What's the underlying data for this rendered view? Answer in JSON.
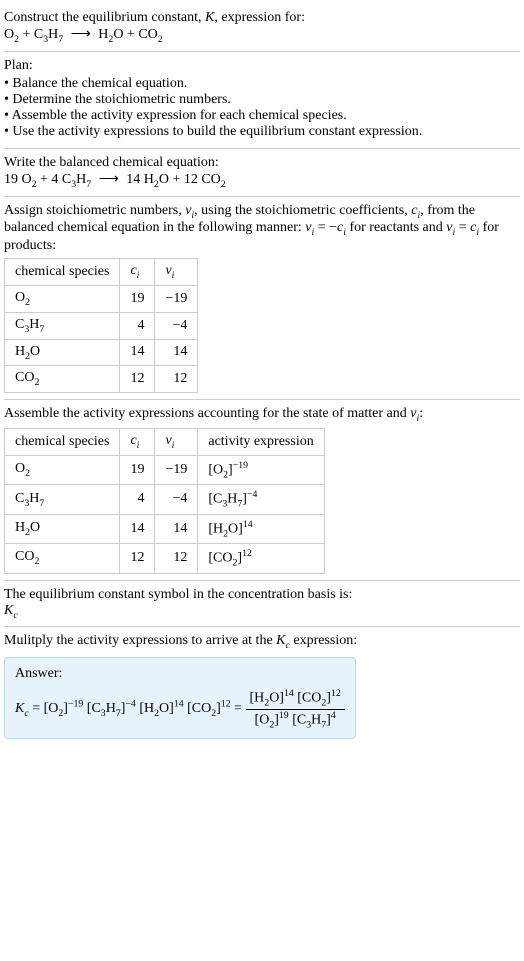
{
  "intro": {
    "line1": "Construct the equilibrium constant, ",
    "k": "K",
    "line1b": ", expression for:",
    "eq_lhs_o2": "O",
    "eq_lhs_o2_sub": "2",
    "eq_plus": " + C",
    "eq_lhs_c3": "3",
    "eq_lhs_h": "H",
    "eq_lhs_h7": "7",
    "arrow": "⟶",
    "eq_rhs_h2o_h": "H",
    "eq_rhs_h2o_2": "2",
    "eq_rhs_h2o_o": "O + CO",
    "eq_rhs_co2_2": "2"
  },
  "plan": {
    "title": "Plan:",
    "items": [
      "Balance the chemical equation.",
      "Determine the stoichiometric numbers.",
      "Assemble the activity expression for each chemical species.",
      "Use the activity expressions to build the equilibrium constant expression."
    ]
  },
  "balanced": {
    "title": "Write the balanced chemical equation:",
    "c19": "19 O",
    "o2_sub": "2",
    "plus4": " + 4 C",
    "c3_sub": "3",
    "h": "H",
    "h7_sub": "7",
    "arrow": "⟶",
    "r14": " 14 H",
    "h2_sub": "2",
    "o_plus12": "O + 12 CO",
    "co2_sub": "2"
  },
  "stoich": {
    "text1": "Assign stoichiometric numbers, ",
    "nu": "ν",
    "i": "i",
    "text2": ", using the stoichiometric coefficients, ",
    "c": "c",
    "text3": ", from the balanced chemical equation in the following manner: ",
    "eq1_lhs": "ν",
    "eq1_eq": " = −",
    "text4": " for reactants and ",
    "eq2_eq": " = ",
    "text5": " for products:",
    "headers": [
      "chemical species",
      "c",
      "ν"
    ],
    "header_sub": "i",
    "rows": [
      {
        "species_pre": "O",
        "species_sub": "2",
        "species_post": "",
        "c": "19",
        "nu": "−19"
      },
      {
        "species_pre": "C",
        "species_sub": "3",
        "species_post": "H",
        "species_sub2": "7",
        "c": "4",
        "nu": "−4"
      },
      {
        "species_pre": "H",
        "species_sub": "2",
        "species_post": "O",
        "c": "14",
        "nu": "14"
      },
      {
        "species_pre": "CO",
        "species_sub": "2",
        "species_post": "",
        "c": "12",
        "nu": "12"
      }
    ]
  },
  "activity": {
    "text1": "Assemble the activity expressions accounting for the state of matter and ",
    "nu": "ν",
    "i": "i",
    "text2": ":",
    "headers": [
      "chemical species",
      "c",
      "ν",
      "activity expression"
    ],
    "header_sub": "i",
    "rows": [
      {
        "species_pre": "O",
        "species_sub": "2",
        "species_post": "",
        "c": "19",
        "nu": "−19",
        "act_pre": "[O",
        "act_sub": "2",
        "act_post": "]",
        "act_sup": "−19"
      },
      {
        "species_pre": "C",
        "species_sub": "3",
        "species_post": "H",
        "species_sub2": "7",
        "c": "4",
        "nu": "−4",
        "act_pre": "[C",
        "act_sub": "3",
        "act_mid": "H",
        "act_sub2": "7",
        "act_post": "]",
        "act_sup": "−4"
      },
      {
        "species_pre": "H",
        "species_sub": "2",
        "species_post": "O",
        "c": "14",
        "nu": "14",
        "act_pre": "[H",
        "act_sub": "2",
        "act_post": "O]",
        "act_sup": "14"
      },
      {
        "species_pre": "CO",
        "species_sub": "2",
        "species_post": "",
        "c": "12",
        "nu": "12",
        "act_pre": "[CO",
        "act_sub": "2",
        "act_post": "]",
        "act_sup": "12"
      }
    ]
  },
  "kc_symbol": {
    "text": "The equilibrium constant symbol in the concentration basis is:",
    "k": "K",
    "c": "c"
  },
  "multiply": {
    "text1": "Mulitply the activity expressions to arrive at the ",
    "k": "K",
    "c": "c",
    "text2": " expression:"
  },
  "answer": {
    "label": "Answer:",
    "k": "K",
    "c": "c",
    "eq": " = [O",
    "o2_sub": "2",
    "o2_post": "]",
    "o2_sup": "−19",
    "c3_pre": " [C",
    "c3_sub": "3",
    "c3_h": "H",
    "c3_h7": "7",
    "c3_post": "]",
    "c3_sup": "−4",
    "h2o_pre": " [H",
    "h2o_sub": "2",
    "h2o_post": "O]",
    "h2o_sup": "14",
    "co2_pre": " [CO",
    "co2_sub": "2",
    "co2_post": "]",
    "co2_sup": "12",
    "eq2": " = ",
    "frac_num_h2o_pre": "[H",
    "frac_num_h2o_sub": "2",
    "frac_num_h2o_post": "O]",
    "frac_num_h2o_sup": "14",
    "frac_num_co2_pre": " [CO",
    "frac_num_co2_sub": "2",
    "frac_num_co2_post": "]",
    "frac_num_co2_sup": "12",
    "frac_den_o2_pre": "[O",
    "frac_den_o2_sub": "2",
    "frac_den_o2_post": "]",
    "frac_den_o2_sup": "19",
    "frac_den_c3_pre": " [C",
    "frac_den_c3_sub": "3",
    "frac_den_c3_h": "H",
    "frac_den_c3_h7": "7",
    "frac_den_c3_post": "]",
    "frac_den_c3_sup": "4"
  }
}
